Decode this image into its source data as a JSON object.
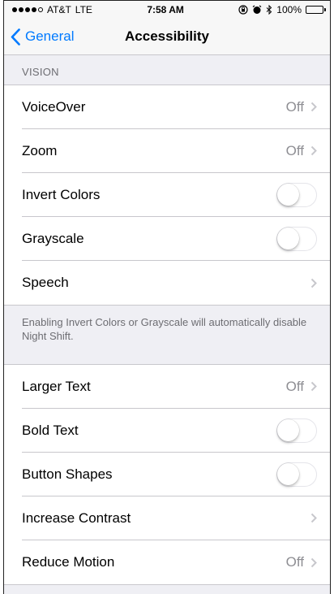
{
  "status_bar": {
    "carrier": "AT&T",
    "network": "LTE",
    "time": "7:58 AM",
    "battery": "100%",
    "signal_bars_filled": 4,
    "signal_bars_total": 5
  },
  "nav": {
    "back_label": "General",
    "title": "Accessibility"
  },
  "sections": {
    "vision_header": "VISION",
    "vision_rows": [
      {
        "label": "VoiceOver",
        "value": "Off"
      },
      {
        "label": "Zoom",
        "value": "Off"
      },
      {
        "label": "Invert Colors",
        "toggle": false
      },
      {
        "label": "Grayscale",
        "toggle": false
      },
      {
        "label": "Speech"
      }
    ],
    "vision_footer": "Enabling Invert Colors or Grayscale will automatically disable Night Shift.",
    "text_rows": [
      {
        "label": "Larger Text",
        "value": "Off"
      },
      {
        "label": "Bold Text",
        "toggle": false
      },
      {
        "label": "Button Shapes",
        "toggle": false
      },
      {
        "label": "Increase Contrast"
      },
      {
        "label": "Reduce Motion",
        "value": "Off"
      }
    ]
  },
  "colors": {
    "accent": "#007aff",
    "background": "#efeff4",
    "separator": "#c8c7cc",
    "secondary_text": "#8e8e93"
  }
}
